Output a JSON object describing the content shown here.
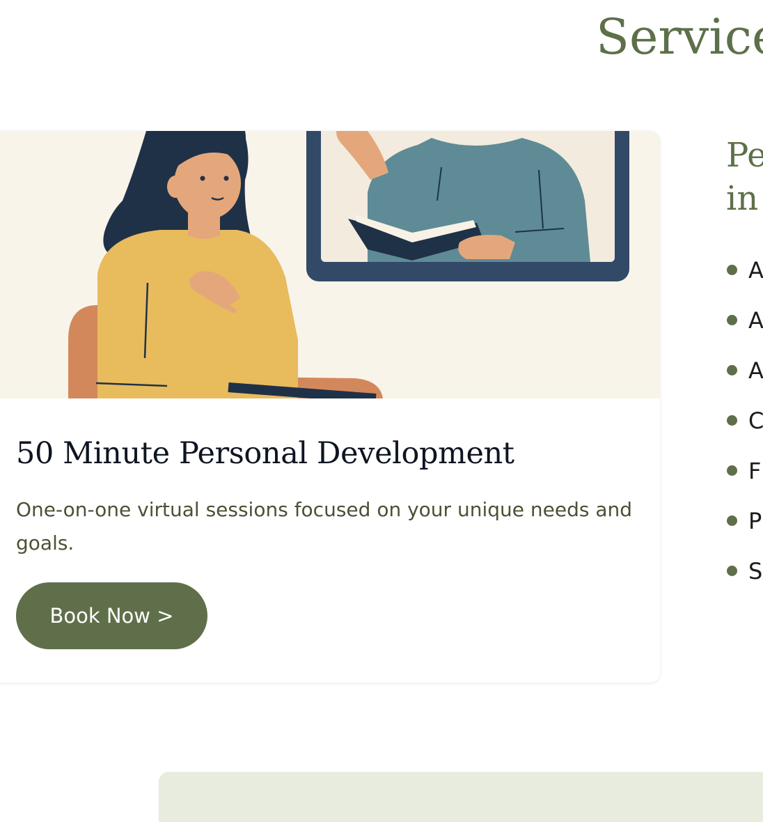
{
  "section": {
    "title": "Service"
  },
  "card": {
    "image_alt": "Illustration of a woman in a virtual session with a person holding a book on a screen",
    "title": "50 Minute Personal Development",
    "description": "One-on-one virtual sessions focused on your unique needs and goals.",
    "button_label": "Book Now >"
  },
  "side": {
    "heading_line1": "Pe",
    "heading_line2": "in",
    "list_items": [
      "A",
      "A",
      "A",
      "C",
      "F",
      "P",
      "S"
    ]
  },
  "colors": {
    "accent": "#5f6f4a",
    "heading_green": "#5d7049",
    "image_background": "#f9f4ea",
    "panel_background": "#e7ecdf"
  }
}
